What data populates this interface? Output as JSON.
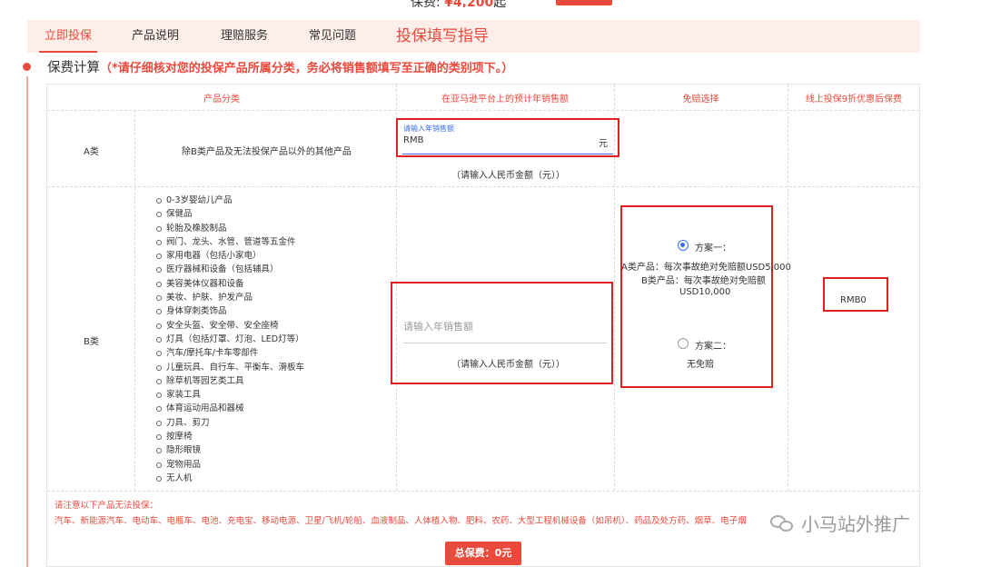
{
  "top": {
    "prefix": "保费: ",
    "amount": "¥4,200",
    "suffix": "起"
  },
  "nav": {
    "tabs": [
      "立即投保",
      "产品说明",
      "理赔服务",
      "常见问题"
    ],
    "guide": "投保填写指导"
  },
  "section": {
    "title": "保费计算",
    "note": "（*请仔细核对您的投保产品所属分类，务必将销售额填写至正确的类别项下。）"
  },
  "table": {
    "headers": [
      "产品分类",
      "在亚马逊平台上的预计年销售额",
      "免赔选择",
      "线上投保9折优惠后保费"
    ],
    "rowA": {
      "cat": "A类",
      "desc": "除B类产品及无法投保产品以外的其他产品",
      "input_label": "请输入年销售额",
      "input_value": "RMB",
      "unit": "元",
      "hint": "（请输入人民币金额（元））"
    },
    "rowB": {
      "cat": "B类",
      "items": [
        "0-3岁婴幼儿产品",
        "保健品",
        "轮胎及橡胶制品",
        "阀门、龙头、水管、管道等五金件",
        "家用电器（包括小家电）",
        "医疗器械和设备（包括辅具）",
        "美容美体仪器和设备",
        "美妆、护肤、护发产品",
        "身体穿刺类饰品",
        "安全头盔、安全带、安全座椅",
        "灯具（包括灯罩、灯泡、LED灯等）",
        "汽车/摩托车/卡车零部件",
        "儿童玩具、自行车、平衡车、滑板车",
        "除草机等园艺类工具",
        "家装工具",
        "体育运动用品和器械",
        "刀具、剪刀",
        "按摩椅",
        "隐形眼镜",
        "宠物用品",
        "无人机"
      ],
      "placeholder": "请输入年销售额",
      "hint": "（请输入人民币金额（元））"
    },
    "deductible": {
      "plan1_label": "方案一：",
      "plan1_line1": "A类产品：每次事故绝对免赔额USD5,000",
      "plan1_line2": "B类产品：每次事故绝对免赔额",
      "plan1_line3": "USD10,000",
      "plan2_label": "方案二：",
      "plan2_desc": "无免赔",
      "selected": "plan1"
    },
    "premium": "RMB0"
  },
  "footer": {
    "note_title": "请注意以下产品无法投保：",
    "note_items": "汽车、新能源汽车、电动车、电瓶车、电池、充电宝、移动电源、卫星/飞机/轮船、血液制品、人体植入物、肥料、农药、大型工程机械设备（如吊机）、药品及处方药、烟草、电子烟",
    "total": "总保费：0元"
  },
  "watermark": "小马站外推广",
  "colors": {
    "accent": "#e94a3c",
    "highlight_box": "#e02020",
    "input_focus": "#3a6ee8",
    "nav_bg": "#fdeee9"
  }
}
